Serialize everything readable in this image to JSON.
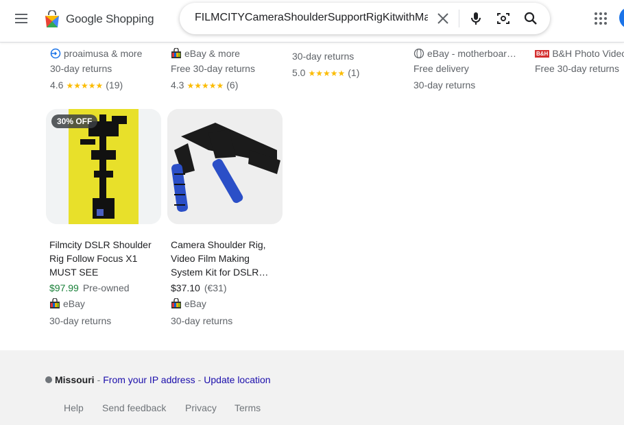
{
  "header": {
    "logo_text": "Google Shopping",
    "search": {
      "value": "FILMCITYCameraShoulderSupportRigKitwithMatteBox"
    }
  },
  "top_row": [
    {
      "merchant": "proaimusa & more",
      "returns": "30-day returns",
      "rating": "4.6",
      "stars": "★★★★★",
      "reviews": "(19)"
    },
    {
      "merchant": "eBay & more",
      "returns": "Free 30-day returns",
      "rating": "4.3",
      "stars": "★★★★★",
      "reviews": "(6)"
    },
    {
      "returns": "30-day returns",
      "rating": "5.0",
      "stars": "★★★★★",
      "reviews": "(1)"
    },
    {
      "merchant": "eBay - motherboar…",
      "delivery": "Free delivery",
      "returns": "30-day returns"
    },
    {
      "merchant": "B&H Photo Video",
      "returns": "Free 30-day returns",
      "merchant_logo": "B&H"
    }
  ],
  "cards": [
    {
      "badge": "30% OFF",
      "title": "Filmcity DSLR Shoulder Rig Follow Focus X1 MUST SEE",
      "price": "$97.99",
      "condition": "Pre-owned",
      "merchant": "eBay",
      "returns": "30-day returns"
    },
    {
      "title": "Camera Shoulder Rig, Video Film Making System Kit for DSLR…",
      "price": "$37.10",
      "condition": "(€31)",
      "merchant": "eBay",
      "returns": "30-day returns"
    }
  ],
  "footer": {
    "location": "Missouri",
    "separator": " - ",
    "from_ip": "From your IP address",
    "update_location": "Update location",
    "links": [
      "Help",
      "Send feedback",
      "Privacy",
      "Terms"
    ]
  },
  "colors": {
    "price_green": "#188038",
    "link_blue": "#1a0dab",
    "star_yellow": "#fbbc04"
  }
}
